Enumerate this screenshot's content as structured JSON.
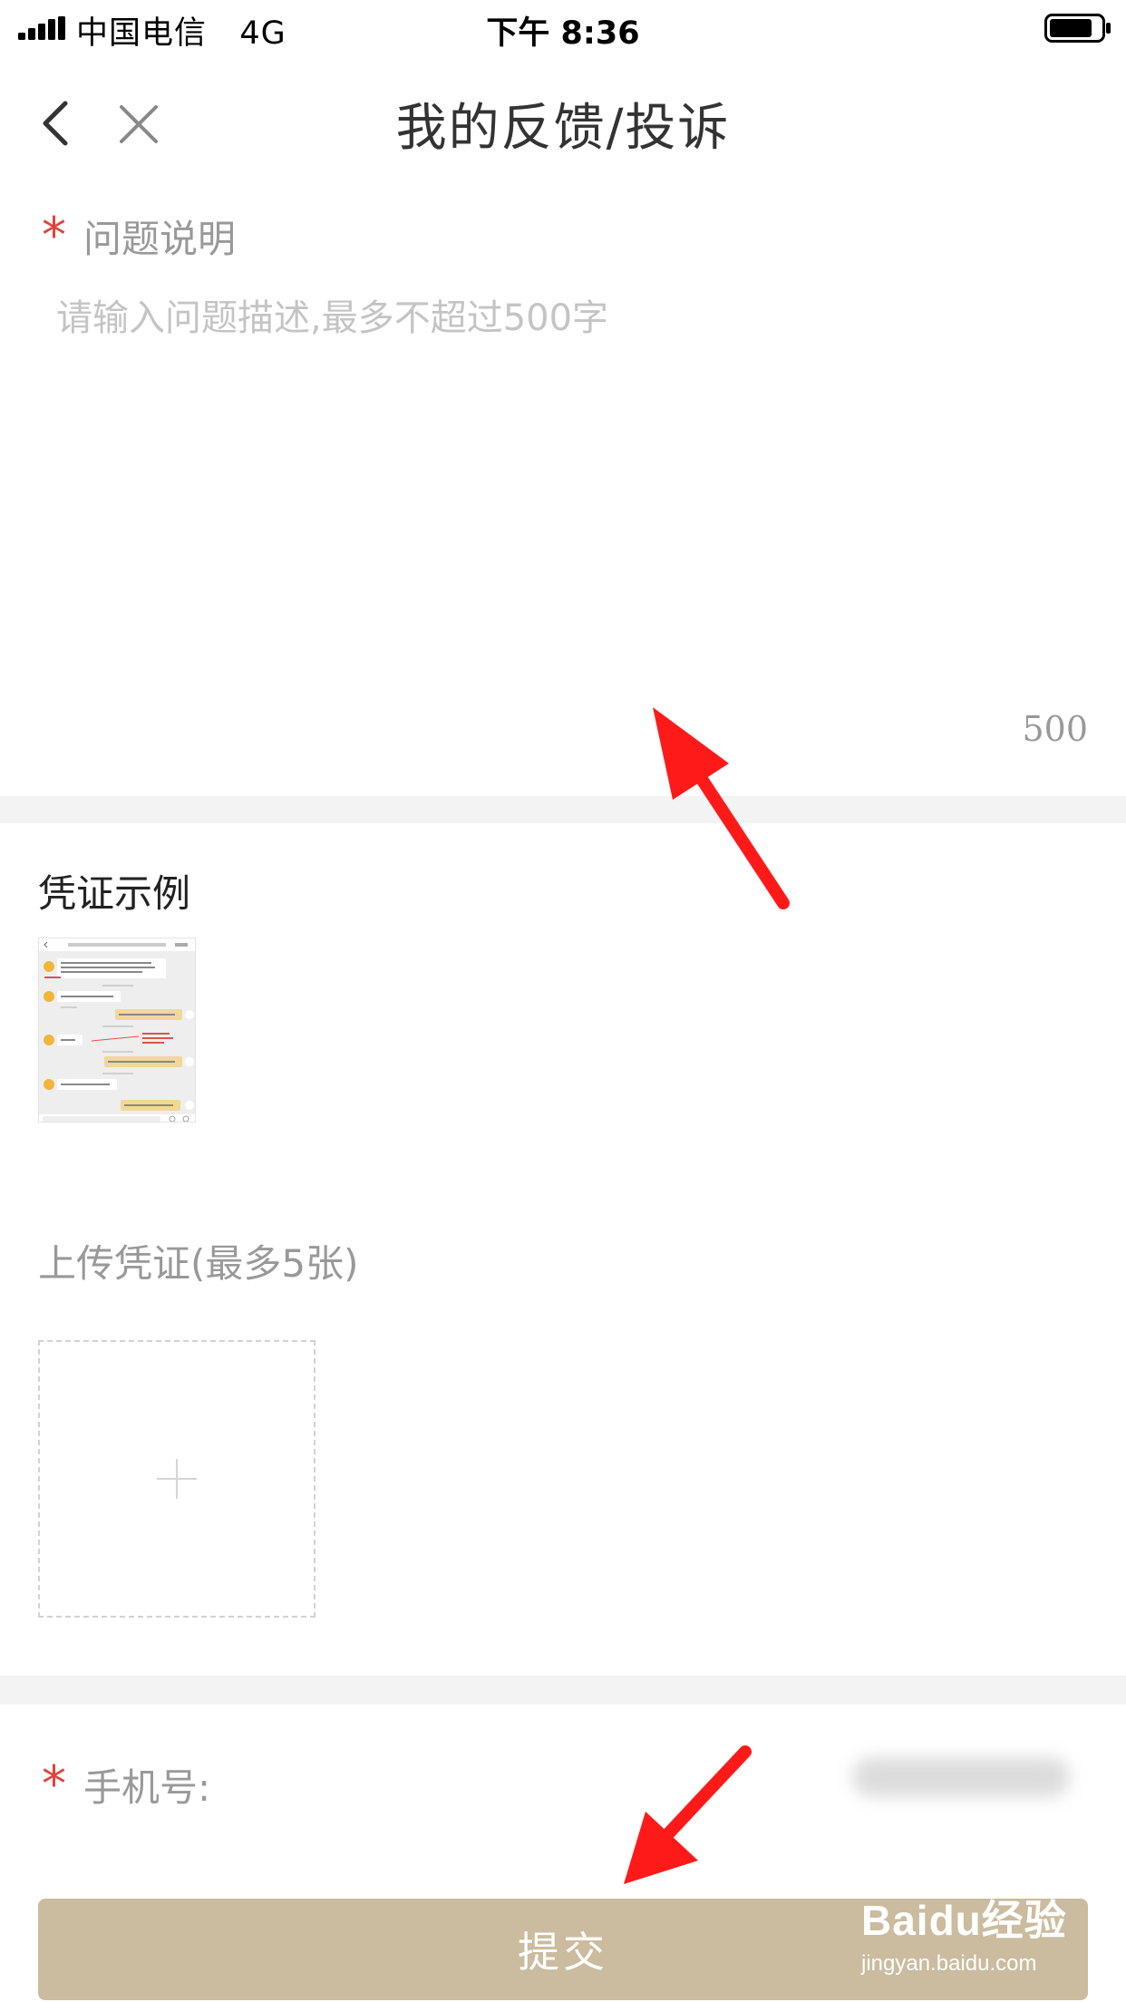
{
  "status_bar": {
    "carrier": "中国电信",
    "network": "4G",
    "time": "下午 8:36"
  },
  "nav": {
    "title": "我的反馈/投诉",
    "back_icon": "chevron-left-icon",
    "close_icon": "close-icon"
  },
  "description": {
    "required_mark": "*",
    "label": "问题说明",
    "placeholder": "请输入问题描述,最多不超过500字",
    "value": "",
    "char_count": "500"
  },
  "evidence": {
    "example_title": "凭证示例",
    "upload_label": "上传凭证(最多5张)",
    "upload_icon": "plus-icon"
  },
  "phone": {
    "required_mark": "*",
    "label": "手机号:"
  },
  "submit": {
    "label": "提交"
  },
  "watermark": {
    "logo": "Baidu经验",
    "url": "jingyan.baidu.com"
  },
  "colors": {
    "required": "#e0443b",
    "submit_bg": "#cbbb9f",
    "annotation_arrow": "#ff0000",
    "divider": "#f3f3f3"
  }
}
